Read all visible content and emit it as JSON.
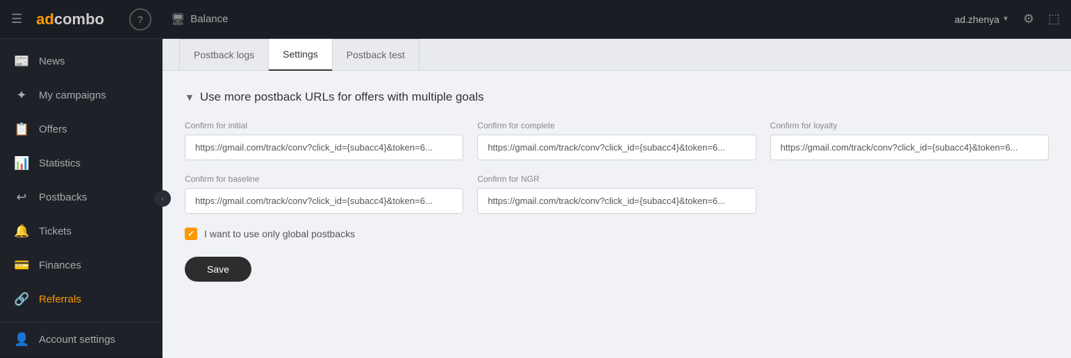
{
  "topbar": {
    "balance_label": "Balance",
    "user": "ad.zhenya",
    "help_icon": "?",
    "menu_icon": "☰"
  },
  "sidebar": {
    "items": [
      {
        "id": "news",
        "label": "News",
        "icon": "📰"
      },
      {
        "id": "my-campaigns",
        "label": "My campaigns",
        "icon": "⚙"
      },
      {
        "id": "offers",
        "label": "Offers",
        "icon": "📋"
      },
      {
        "id": "statistics",
        "label": "Statistics",
        "icon": "📊"
      },
      {
        "id": "postbacks",
        "label": "Postbacks",
        "icon": "↩"
      },
      {
        "id": "tickets",
        "label": "Tickets",
        "icon": "🔔"
      },
      {
        "id": "finances",
        "label": "Finances",
        "icon": "💳"
      },
      {
        "id": "referrals",
        "label": "Referrals",
        "icon": "🔗",
        "active": true
      }
    ],
    "footer": {
      "label": "Account settings",
      "icon": "👤"
    }
  },
  "tabs": [
    {
      "id": "postback-logs",
      "label": "Postback logs",
      "active": false
    },
    {
      "id": "settings",
      "label": "Settings",
      "active": true
    },
    {
      "id": "postback-test",
      "label": "Postback test",
      "active": false
    }
  ],
  "section": {
    "title": "Use more postback URLs for offers with multiple goals"
  },
  "fields": {
    "confirm_initial": {
      "label": "Confirm for initial",
      "value": "https://gmail.com/track/conv?click_id={subacc4}&token=6..."
    },
    "confirm_complete": {
      "label": "Confirm for complete",
      "value": "https://gmail.com/track/conv?click_id={subacc4}&token=6..."
    },
    "confirm_loyalty": {
      "label": "Confirm for loyalty",
      "value": "https://gmail.com/track/conv?click_id={subacc4}&token=6..."
    },
    "confirm_baseline": {
      "label": "Confirm for baseline",
      "value": "https://gmail.com/track/conv?click_id={subacc4}&token=6..."
    },
    "confirm_ngr": {
      "label": "Confirm for NGR",
      "value": "https://gmail.com/track/conv?click_id={subacc4}&token=6..."
    }
  },
  "checkbox": {
    "label": "I want to use only global postbacks",
    "checked": true
  },
  "save_button": "Save"
}
